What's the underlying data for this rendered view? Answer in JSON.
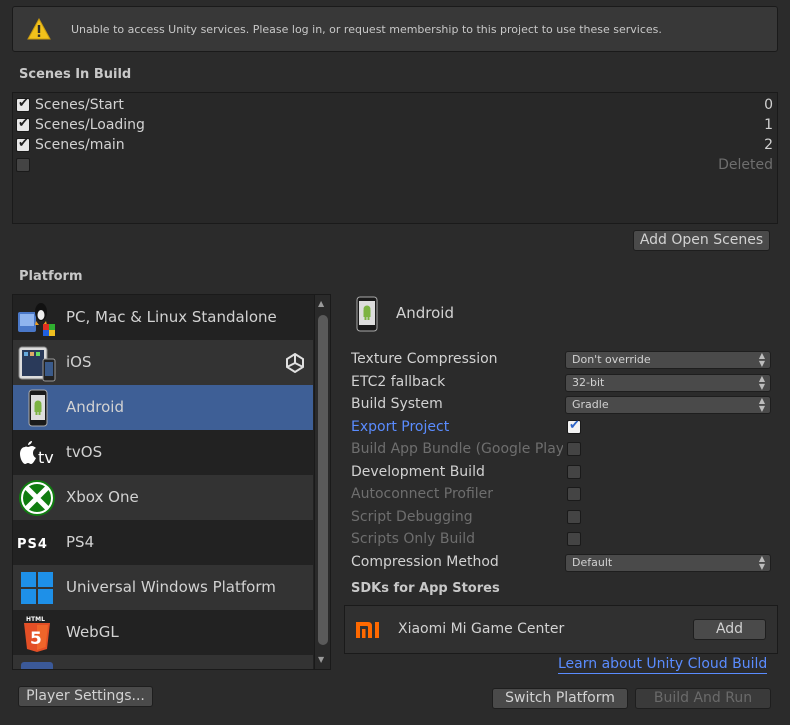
{
  "warning": {
    "message": "Unable to access Unity services. Please log in, or request membership to this project to use these services.",
    "icon": "warning-icon"
  },
  "scenes_header": "Scenes In Build",
  "scenes": [
    {
      "name": "Scenes/Start",
      "index": "0",
      "checked": true
    },
    {
      "name": "Scenes/Loading",
      "index": "1",
      "checked": true
    },
    {
      "name": "Scenes/main",
      "index": "2",
      "checked": true
    },
    {
      "name": "",
      "index": "Deleted",
      "checked": false
    }
  ],
  "add_open_scenes_label": "Add Open Scenes",
  "platform_header": "Platform",
  "platforms": [
    {
      "label": "PC, Mac & Linux Standalone",
      "icon": "standalone-icon"
    },
    {
      "label": "iOS",
      "icon": "ios-device-icon"
    },
    {
      "label": "Android",
      "icon": "android-device-icon",
      "selected": true
    },
    {
      "label": "tvOS",
      "icon": "apple-tv-icon"
    },
    {
      "label": "Xbox One",
      "icon": "xbox-icon"
    },
    {
      "label": "PS4",
      "icon": "ps4-icon"
    },
    {
      "label": "Universal Windows Platform",
      "icon": "windows-icon"
    },
    {
      "label": "WebGL",
      "icon": "html5-icon"
    }
  ],
  "selected_platform": {
    "title": "Android",
    "settings": {
      "texture_compression": {
        "label": "Texture Compression",
        "value": "Don't override"
      },
      "etc2_fallback": {
        "label": "ETC2 fallback",
        "value": "32-bit"
      },
      "build_system": {
        "label": "Build System",
        "value": "Gradle"
      },
      "export_project": {
        "label": "Export Project",
        "checked": true
      },
      "build_app_bundle": {
        "label": "Build App Bundle (Google Play)",
        "checked": false
      },
      "development_build": {
        "label": "Development Build",
        "checked": false
      },
      "autoconnect_profiler": {
        "label": "Autoconnect Profiler",
        "checked": false
      },
      "script_debugging": {
        "label": "Script Debugging",
        "checked": false
      },
      "scripts_only_build": {
        "label": "Scripts Only Build",
        "checked": false
      },
      "compression_method": {
        "label": "Compression Method",
        "value": "Default"
      }
    }
  },
  "sdk_header": "SDKs for App Stores",
  "sdk": {
    "name": "Xiaomi Mi Game Center",
    "add_label": "Add",
    "logo": "xiaomi-logo"
  },
  "cloud_build_link": "Learn about Unity Cloud Build",
  "buttons": {
    "player_settings": "Player Settings...",
    "switch_platform": "Switch Platform",
    "build_and_run": "Build And Run"
  },
  "colors": {
    "background": "#2b2b2b",
    "selection": "#3e5f96",
    "link": "#5a8cff",
    "warning": "#f2c21b"
  }
}
